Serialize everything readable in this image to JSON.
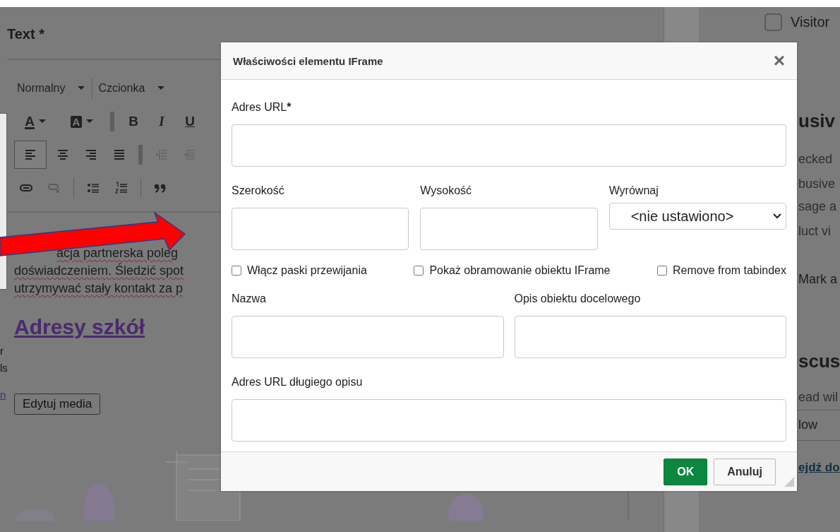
{
  "left_fragments": [
    {
      "text": "r",
      "kind": "plain"
    },
    {
      "text": "ls",
      "kind": "plain"
    },
    {
      "text": "n",
      "kind": "link"
    }
  ],
  "editor": {
    "title": "Text *",
    "toolbar_rows": [
      [
        {
          "kind": "dropdown",
          "label": "Normalny"
        },
        {
          "kind": "dropdown",
          "label": "Czcionka"
        }
      ],
      [
        {
          "kind": "text-color",
          "label": "A",
          "disabled": false
        },
        {
          "kind": "bg-color",
          "label": "A",
          "disabled": false
        },
        {
          "kind": "separator"
        },
        {
          "kind": "bold",
          "label": "B",
          "disabled": false
        },
        {
          "kind": "italic",
          "label": "I",
          "disabled": false
        },
        {
          "kind": "underline",
          "label": "U",
          "disabled": false
        }
      ],
      [
        {
          "kind": "align-left",
          "selected": true,
          "disabled": false
        },
        {
          "kind": "align-center",
          "selected": false,
          "disabled": false
        },
        {
          "kind": "align-right",
          "selected": false,
          "disabled": false
        },
        {
          "kind": "justify",
          "selected": false,
          "disabled": false
        },
        {
          "kind": "separator"
        },
        {
          "kind": "outdent",
          "disabled": true
        },
        {
          "kind": "indent",
          "disabled": true
        }
      ],
      [
        {
          "kind": "link",
          "disabled": false
        },
        {
          "kind": "unlink",
          "disabled": true
        },
        {
          "kind": "separator"
        },
        {
          "kind": "bullets",
          "disabled": false
        },
        {
          "kind": "numbers",
          "disabled": false
        },
        {
          "kind": "separator"
        },
        {
          "kind": "quote",
          "disabled": false
        }
      ]
    ],
    "paragraph_lines": [
      "acja partnerska poleg",
      "doświadczeniem. Śledzić spot",
      "utrzymywać stały kontakt za p"
    ],
    "heading": "Adresy szkół",
    "edit_media_button": "Edytuj media"
  },
  "sidebar": {
    "visitor_checkbox": {
      "label": "Visitor",
      "checked": false
    },
    "heading_1": "usiv",
    "lines": [
      "ecked",
      "busive",
      "sage a",
      "luct vi"
    ],
    "mark_label": "Mark a",
    "heading_2": "scus",
    "subtext": "ead wil",
    "row": "low",
    "link": "ejdź do"
  },
  "dialog": {
    "title": "Właściwości elementu IFrame",
    "close": "×",
    "field_rows": [
      [
        {
          "kind": "text",
          "label": "Adres URL",
          "mark": "*"
        }
      ],
      [
        {
          "kind": "text",
          "label": "Szerokość"
        },
        {
          "kind": "text",
          "label": "Wysokość"
        },
        {
          "kind": "select",
          "label": "Wyrównaj",
          "value": "<nie ustawiono>"
        }
      ],
      [
        {
          "kind": "checkboxes",
          "items": [
            {
              "label": "Włącz paski przewijania",
              "checked": false
            },
            {
              "label": "Pokaż obramowanie obiektu IFrame",
              "checked": false
            },
            {
              "label": "Remove from tabindex",
              "checked": false
            }
          ]
        }
      ],
      [
        {
          "kind": "text",
          "label": "Nazwa"
        },
        {
          "kind": "text",
          "label": "Opis obiektu docelowego"
        }
      ],
      [
        {
          "kind": "text",
          "label": "Adres URL długiego opisu"
        }
      ]
    ],
    "buttons": [
      {
        "label": "OK",
        "kind": "primary"
      },
      {
        "label": "Anuluj",
        "kind": "secondary"
      }
    ]
  }
}
